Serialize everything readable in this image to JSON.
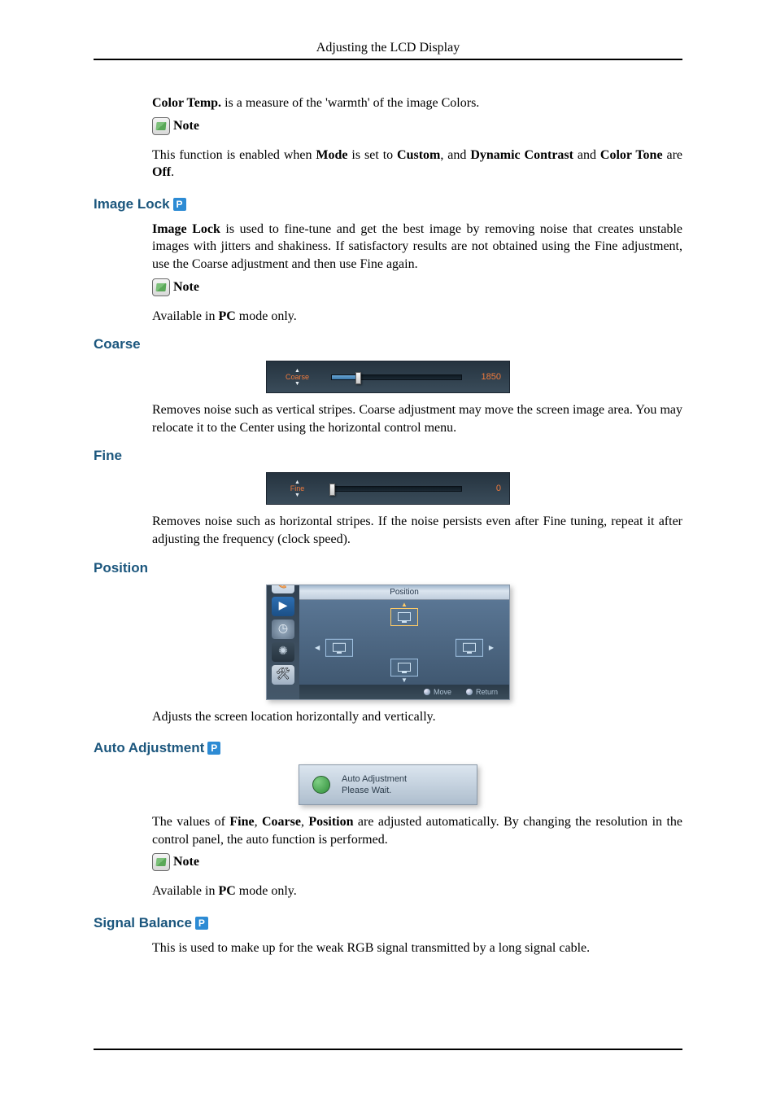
{
  "header": {
    "title": "Adjusting the LCD Display"
  },
  "colorTemp": {
    "line1_pre": "Color Temp.",
    "line1_post": " is a measure of the 'warmth' of the image Colors.",
    "note_label": "Note",
    "note_text_pre": "This function is enabled when ",
    "mode": "Mode",
    "note_text_mid1": " is set to ",
    "custom": "Custom",
    "note_text_mid2": ", and ",
    "dyn": "Dynamic Contrast",
    "note_text_mid3": " and ",
    "tone": "Color Tone",
    "note_text_mid4": " are ",
    "off": "Off",
    "note_text_end": "."
  },
  "imageLock": {
    "title": "Image Lock",
    "badge": "P",
    "para_bold": "Image Lock",
    "para_rest": " is used to fine-tune and get the best image by removing noise that creates unstable images with jitters and shakiness. If satisfactory results are not obtained using the Fine adjustment, use the Coarse adjustment and then use Fine again.",
    "note_label": "Note",
    "note_text_pre": "Available in ",
    "pc": "PC",
    "note_text_post": " mode only."
  },
  "coarse": {
    "title": "Coarse",
    "slider_label": "Coarse",
    "value": "1850",
    "desc": "Removes noise such as vertical stripes. Coarse adjustment may move the screen image area. You may relocate it to the Center using the horizontal control menu."
  },
  "fine": {
    "title": "Fine",
    "slider_label": "Fine",
    "value": "0",
    "desc": "Removes noise such as horizontal stripes. If the noise persists even after Fine tuning, repeat it after adjusting the frequency (clock speed)."
  },
  "position": {
    "title": "Position",
    "osd_title": "Position",
    "move": "Move",
    "return": "Return",
    "desc": "Adjusts the screen location horizontally and vertically."
  },
  "autoAdj": {
    "title": "Auto Adjustment",
    "badge": "P",
    "panel_line1": "Auto Adjustment",
    "panel_line2": "Please Wait.",
    "desc_pre": "The values of ",
    "b1": "Fine",
    "sep1": ", ",
    "b2": "Coarse",
    "sep2": ", ",
    "b3": "Position",
    "desc_post": " are adjusted automatically. By changing the resolution in the control panel, the auto function is performed.",
    "note_label": "Note",
    "note_text_pre": "Available in ",
    "pc": "PC",
    "note_text_post": " mode only."
  },
  "signalBalance": {
    "title": "Signal Balance",
    "badge": "P",
    "desc": "This is used to make up for the weak RGB signal transmitted by a long signal cable."
  }
}
